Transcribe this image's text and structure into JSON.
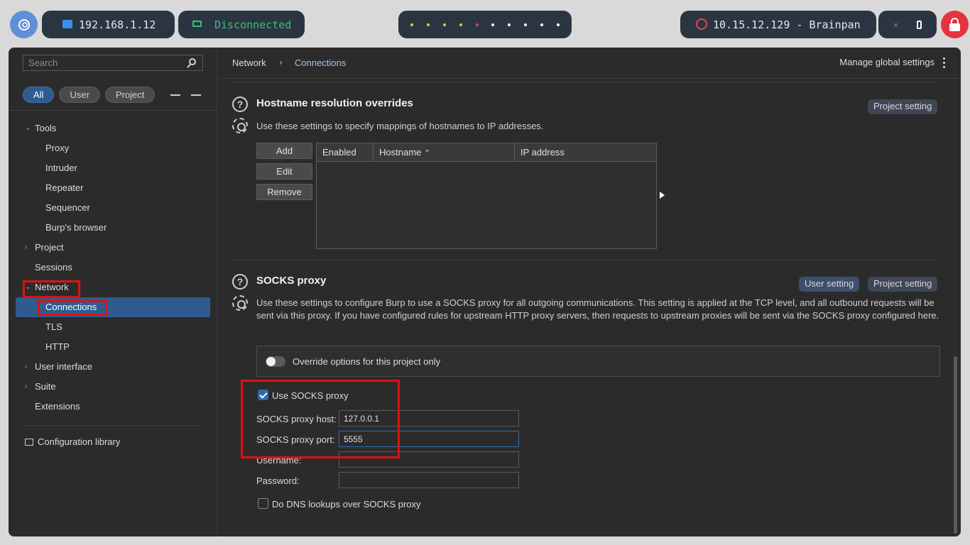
{
  "topbar": {
    "ip": "192.168.1.12",
    "vpn_status": "Disconnected",
    "target": "10.15.12.129 - Brainpan",
    "colors": {
      "pill_bg": "#2b3542",
      "vpn_green": "#35c46a",
      "accent_red": "#e5343f"
    }
  },
  "sidebar": {
    "search_placeholder": "Search",
    "filters": [
      "All",
      "User",
      "Project"
    ],
    "tree": [
      {
        "label": "Tools",
        "level": 1,
        "expanded": true
      },
      {
        "label": "Proxy",
        "level": 2
      },
      {
        "label": "Intruder",
        "level": 2
      },
      {
        "label": "Repeater",
        "level": 2
      },
      {
        "label": "Sequencer",
        "level": 2
      },
      {
        "label": "Burp's browser",
        "level": 2
      },
      {
        "label": "Project",
        "level": 1,
        "expanded": false
      },
      {
        "label": "Sessions",
        "level": 1
      },
      {
        "label": "Network",
        "level": 1,
        "expanded": true
      },
      {
        "label": "Connections",
        "level": 2,
        "selected": true
      },
      {
        "label": "TLS",
        "level": 2
      },
      {
        "label": "HTTP",
        "level": 2
      },
      {
        "label": "User interface",
        "level": 1,
        "expanded": false
      },
      {
        "label": "Suite",
        "level": 1,
        "expanded": false
      },
      {
        "label": "Extensions",
        "level": 1
      }
    ],
    "config_library": "Configuration library"
  },
  "breadcrumb": {
    "root": "Network",
    "current": "Connections"
  },
  "manage_label": "Manage global settings",
  "hostname_section": {
    "title": "Hostname resolution overrides",
    "description": "Use these settings to specify mappings of hostnames to IP addresses.",
    "tag": "Project setting",
    "buttons": {
      "add": "Add",
      "edit": "Edit",
      "remove": "Remove"
    },
    "columns": [
      "Enabled",
      "Hostname",
      "IP address"
    ]
  },
  "socks_section": {
    "title": "SOCKS proxy",
    "description": "Use these settings to configure Burp to use a SOCKS proxy for all outgoing communications. This setting is applied at the TCP level, and all outbound requests will be sent via this proxy. If you have configured rules for upstream HTTP proxy servers, then requests to upstream proxies will be sent via the SOCKS proxy configured here.",
    "tag_user": "User setting",
    "tag_project": "Project setting",
    "override_label": "Override options for this project only",
    "use_socks_label": "Use SOCKS proxy",
    "use_socks_checked": true,
    "host_label": "SOCKS proxy host:",
    "host_value": "127.0.0.1",
    "port_label": "SOCKS proxy port:",
    "port_value": "5555",
    "username_label": "Username:",
    "username_value": "",
    "password_label": "Password:",
    "password_value": "",
    "dns_label": "Do DNS lookups over SOCKS proxy",
    "dns_checked": false
  }
}
